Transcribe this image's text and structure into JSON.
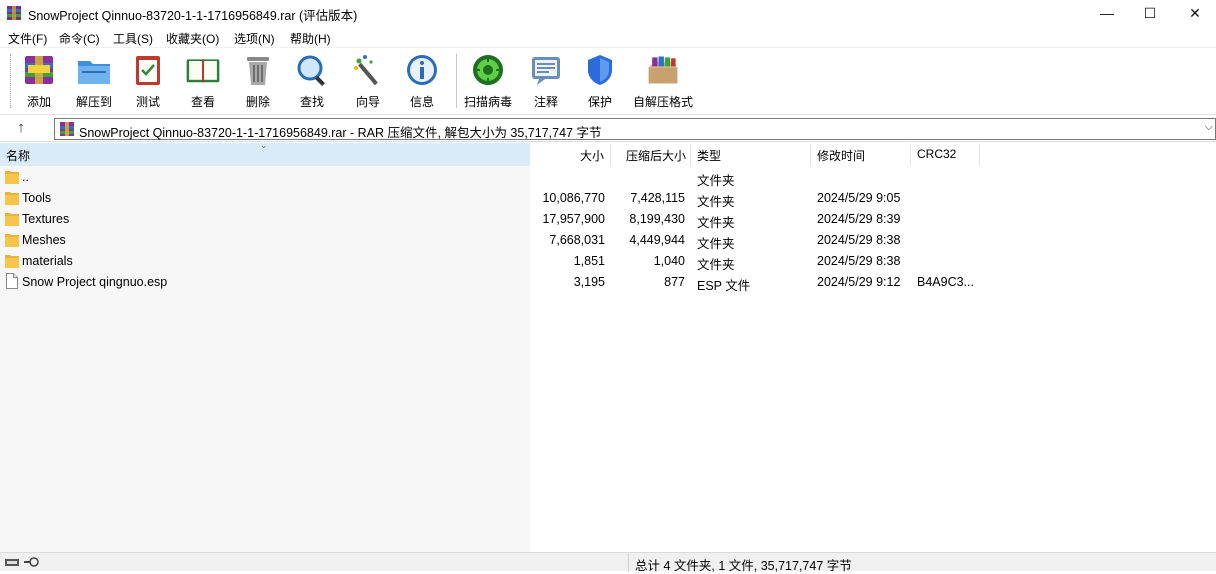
{
  "window": {
    "title": "SnowProject Qinnuo-83720-1-1-1716956849.rar (评估版本)",
    "minimize_glyph": "—",
    "maximize_glyph": "☐",
    "close_glyph": "✕"
  },
  "menu": {
    "file": "文件(F)",
    "command": "命令(C)",
    "tools": "工具(S)",
    "favorites": "收藏夹(O)",
    "options": "选项(N)",
    "help": "帮助(H)"
  },
  "toolbar": {
    "add": "添加",
    "extract_to": "解压到",
    "test": "测试",
    "view": "查看",
    "delete": "删除",
    "find": "查找",
    "wizard": "向导",
    "info": "信息",
    "virus_scan": "扫描病毒",
    "comment": "注释",
    "protect": "保护",
    "sfx": "自解压格式"
  },
  "address": {
    "up_glyph": "↑",
    "path": "SnowProject Qinnuo-83720-1-1-1716956849.rar - RAR 压缩文件, 解包大小为 35,717,747 字节",
    "dropdown_glyph": "⌵"
  },
  "columns": {
    "name": "名称",
    "size": "大小",
    "packed": "压缩后大小",
    "type": "类型",
    "modified": "修改时间",
    "crc": "CRC32"
  },
  "files": [
    {
      "name": "..",
      "size": "",
      "packed": "",
      "type": "文件夹",
      "modified": "",
      "crc": "",
      "icon": "folder-icon"
    },
    {
      "name": "Tools",
      "size": "10,086,770",
      "packed": "7,428,115",
      "type": "文件夹",
      "modified": "2024/5/29 9:05",
      "crc": "",
      "icon": "folder-icon"
    },
    {
      "name": "Textures",
      "size": "17,957,900",
      "packed": "8,199,430",
      "type": "文件夹",
      "modified": "2024/5/29 8:39",
      "crc": "",
      "icon": "folder-icon"
    },
    {
      "name": "Meshes",
      "size": "7,668,031",
      "packed": "4,449,944",
      "type": "文件夹",
      "modified": "2024/5/29 8:38",
      "crc": "",
      "icon": "folder-icon"
    },
    {
      "name": "materials",
      "size": "1,851",
      "packed": "1,040",
      "type": "文件夹",
      "modified": "2024/5/29 8:38",
      "crc": "",
      "icon": "folder-icon"
    },
    {
      "name": "Snow Project qingnuo.esp",
      "size": "3,195",
      "packed": "877",
      "type": "ESP 文件",
      "modified": "2024/5/29 9:12",
      "crc": "B4A9C3...",
      "icon": "file-icon"
    }
  ],
  "status": {
    "summary": "总计 4 文件夹, 1 文件, 35,717,747 字节"
  },
  "colors": {
    "folder": "#f6c54a",
    "header_selected": "#d9ebf9",
    "left_pane": "#f7f7f7"
  }
}
